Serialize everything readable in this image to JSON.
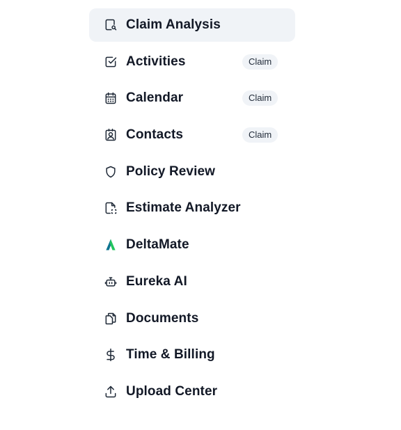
{
  "sidebar": {
    "items": [
      {
        "label": "Claim Analysis",
        "icon": "claim-analysis-icon",
        "active": true
      },
      {
        "label": "Activities",
        "icon": "checkbox-icon",
        "badge": "Claim"
      },
      {
        "label": "Calendar",
        "icon": "calendar-icon",
        "badge": "Claim"
      },
      {
        "label": "Contacts",
        "icon": "contact-card-icon",
        "badge": "Claim"
      },
      {
        "label": "Policy Review",
        "icon": "shield-icon"
      },
      {
        "label": "Estimate Analyzer",
        "icon": "file-scan-icon"
      },
      {
        "label": "DeltaMate",
        "icon": "deltamate-logo-icon"
      },
      {
        "label": "Eureka AI",
        "icon": "robot-icon"
      },
      {
        "label": "Documents",
        "icon": "documents-icon"
      },
      {
        "label": "Time & Billing",
        "icon": "dollar-icon"
      },
      {
        "label": "Upload Center",
        "icon": "upload-icon"
      }
    ]
  },
  "colors": {
    "active_bg": "#f0f3f7",
    "text": "#121826",
    "badge_bg": "#f0f3f7",
    "deltamate_green": "#22c55e",
    "deltamate_teal": "#0e7490"
  }
}
